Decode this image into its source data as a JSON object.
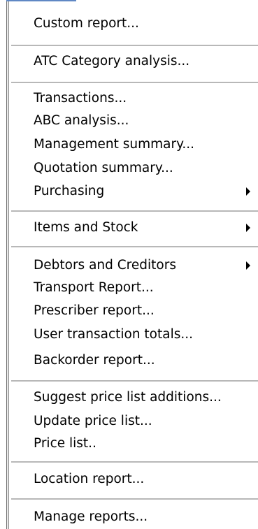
{
  "menu": {
    "items": [
      {
        "label": "Custom report..."
      },
      {
        "label": "ATC Category analysis..."
      },
      {
        "label": "Transactions..."
      },
      {
        "label": "ABC analysis..."
      },
      {
        "label": "Management summary..."
      },
      {
        "label": "Quotation summary..."
      },
      {
        "label": "Purchasing"
      },
      {
        "label": "Items and Stock"
      },
      {
        "label": "Debtors and  Creditors"
      },
      {
        "label": "Transport Report..."
      },
      {
        "label": "Prescriber report..."
      },
      {
        "label": "User transaction totals..."
      },
      {
        "label": "Backorder report..."
      },
      {
        "label": "Suggest price list additions..."
      },
      {
        "label": "Update price list..."
      },
      {
        "label": "Price list.."
      },
      {
        "label": "Location report..."
      },
      {
        "label": "Manage reports..."
      }
    ],
    "submenu_arrow_icon": "triangle-right-icon"
  }
}
